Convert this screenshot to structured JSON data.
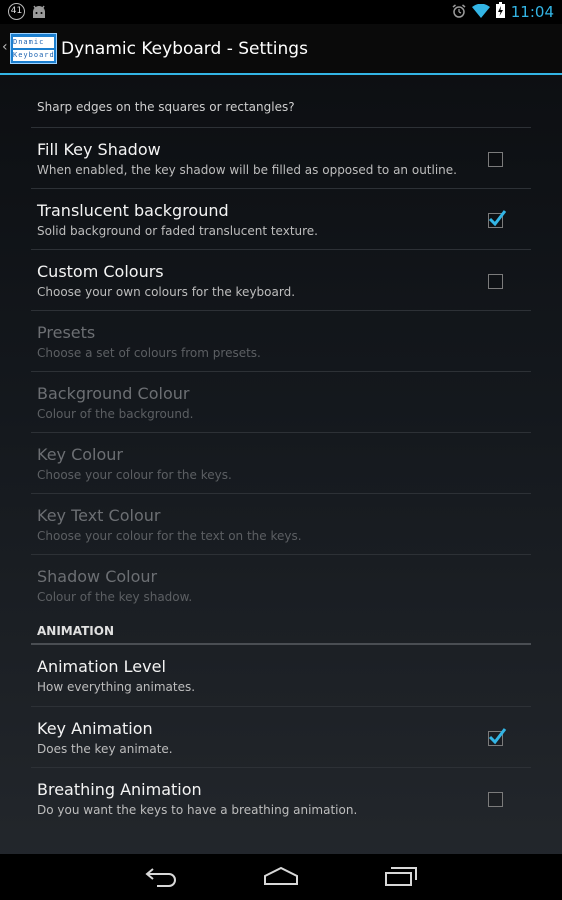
{
  "status_bar": {
    "notification_count": "41",
    "time": "11:04",
    "icons": [
      "android-icon",
      "alarm-icon",
      "wifi-icon",
      "battery-charging-icon"
    ]
  },
  "action_bar": {
    "title": "Dynamic Keyboard - Settings",
    "logo_line1": "Dnamic",
    "logo_line2": "Keyboard"
  },
  "list": {
    "cut_off_summary": "Sharp edges on the squares or rectangles?",
    "items": [
      {
        "title": "Fill Key Shadow",
        "summary": "When enabled, the key shadow will be filled as opposed to an outline.",
        "checked": false,
        "enabled": true
      },
      {
        "title": "Translucent background",
        "summary": "Solid background or faded translucent texture.",
        "checked": true,
        "enabled": true
      },
      {
        "title": "Custom Colours",
        "summary": "Choose your own colours for the keyboard.",
        "checked": false,
        "enabled": true
      },
      {
        "title": "Presets",
        "summary": "Choose a set of colours from presets.",
        "enabled": false
      },
      {
        "title": "Background Colour",
        "summary": "Colour of the background.",
        "enabled": false
      },
      {
        "title": "Key Colour",
        "summary": "Choose your colour for the keys.",
        "enabled": false
      },
      {
        "title": "Key Text Colour",
        "summary": "Choose your colour for the text on the keys.",
        "enabled": false
      },
      {
        "title": "Shadow Colour",
        "summary": "Colour of the key shadow.",
        "enabled": false
      }
    ],
    "section_header": "ANIMATION",
    "animation_items": [
      {
        "title": "Animation Level",
        "summary": "How everything animates.",
        "enabled": true
      },
      {
        "title": "Key Animation",
        "summary": "Does the key animate.",
        "checked": true,
        "enabled": true
      },
      {
        "title": "Breathing Animation",
        "summary": "Do you want the keys to have a breathing animation.",
        "checked": false,
        "enabled": true
      }
    ]
  },
  "nav_bar": {
    "icons": [
      "back-icon",
      "home-icon",
      "recents-icon"
    ]
  },
  "colors": {
    "accent": "#33b5e5",
    "disabled_text": "#6c6f73"
  }
}
